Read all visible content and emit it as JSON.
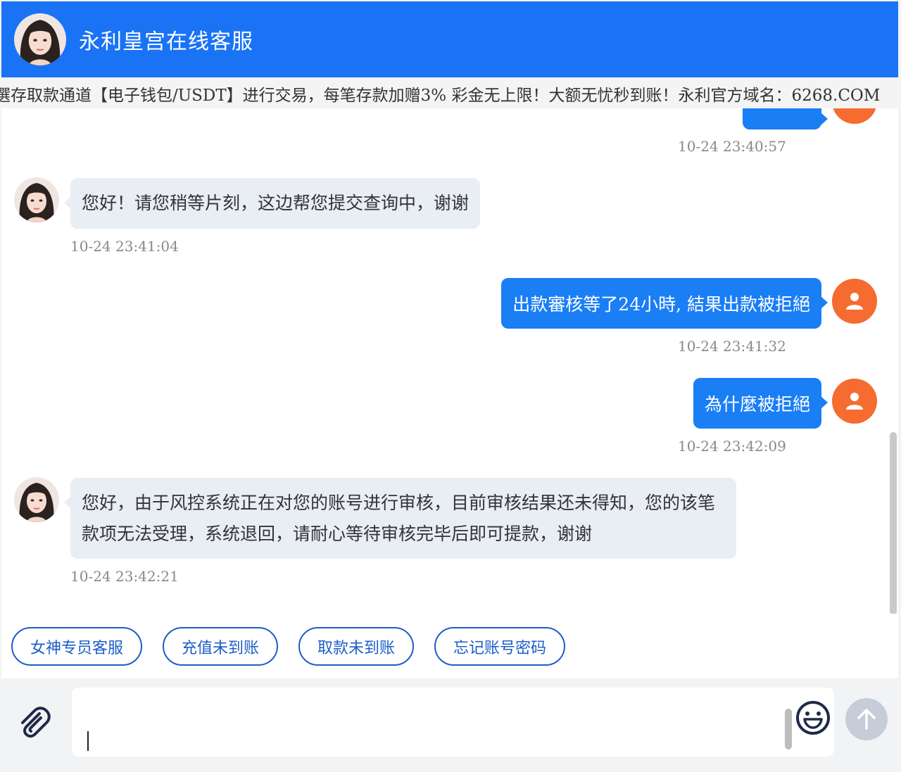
{
  "header": {
    "title": "永利皇宫在线客服",
    "accent": "#1a73f5"
  },
  "marquee": {
    "text": "選存取款通道【电子钱包/USDT】进行交易，每笔存款加赠3% 彩金无上限！大额无忧秒到账！永利官方域名：6268.COM"
  },
  "messages": [
    {
      "side": "right",
      "text": "",
      "time": "10-24 23:40:57"
    },
    {
      "side": "left",
      "text": "您好！请您稍等片刻，这边帮您提交查询中，谢谢",
      "time": "10-24 23:41:04"
    },
    {
      "side": "right",
      "text": "出款審核等了24小時, 結果出款被拒絕",
      "time": "10-24 23:41:32"
    },
    {
      "side": "right",
      "text": "為什麼被拒絕",
      "time": "10-24 23:42:09"
    },
    {
      "side": "left",
      "text": "您好，由于风控系统正在对您的账号进行审核，目前审核结果还未得知，您的该笔款项无法受理，系统退回，请耐心等待审核完毕后即可提款，谢谢",
      "time": "10-24 23:42:21"
    }
  ],
  "quick_replies": [
    "女神专员客服",
    "充值未到账",
    "取款未到账",
    "忘记账号密码"
  ],
  "input": {
    "value": ""
  },
  "colors": {
    "user_bubble": "#1a7ef5",
    "agent_bubble": "#e9edf4",
    "user_avatar": "#f56b30",
    "quick_border": "#1c5ec7"
  },
  "icons": {
    "attach": "paperclip-icon",
    "emoji": "smiley-icon",
    "send": "arrow-up-icon",
    "user": "person-icon"
  }
}
